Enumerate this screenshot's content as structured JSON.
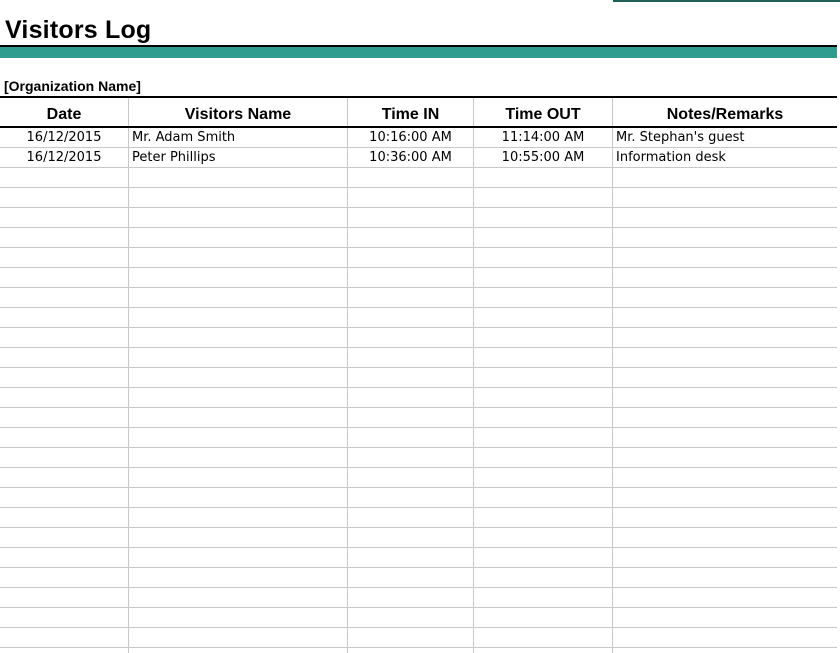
{
  "sheet": {
    "title": "Visitors Log",
    "organization": "[Organization Name]",
    "accent_color": "#2e9c8f",
    "columns": [
      "Date",
      "Visitors Name",
      "Time IN",
      "Time OUT",
      "Notes/Remarks"
    ],
    "rows": [
      {
        "date": "16/12/2015",
        "name": "Mr. Adam Smith",
        "time_in": "10:16:00 AM",
        "time_out": "11:14:00 AM",
        "notes": "Mr. Stephan's guest"
      },
      {
        "date": "16/12/2015",
        "name": "Peter Phillips",
        "time_in": "10:36:00 AM",
        "time_out": "10:55:00 AM",
        "notes": "Information desk"
      }
    ]
  }
}
